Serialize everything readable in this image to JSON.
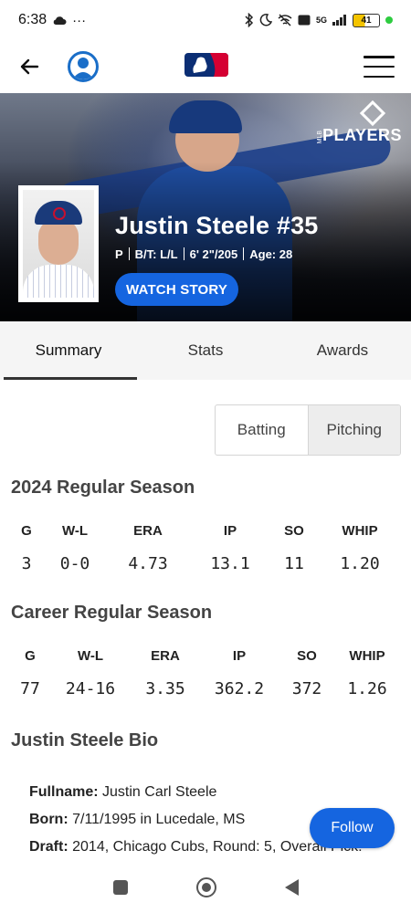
{
  "status_bar": {
    "time": "6:38",
    "dots": "···",
    "network": "5G",
    "battery": "41"
  },
  "nav": {
    "logo_alt": "MLB"
  },
  "hero": {
    "brand": "PLAYERS",
    "brand_small": "MLB",
    "name": "Justin Steele #35",
    "position": "P",
    "bats_throws": "B/T: L/L",
    "height_weight": "6' 2\"/205",
    "age": "Age: 28",
    "watch_label": "WATCH STORY"
  },
  "tabs": [
    {
      "label": "Summary",
      "active": true
    },
    {
      "label": "Stats",
      "active": false
    },
    {
      "label": "Awards",
      "active": false
    }
  ],
  "toggle": {
    "batting": "Batting",
    "pitching": "Pitching",
    "selected": "Pitching"
  },
  "season": {
    "title": "2024 Regular Season",
    "headers": [
      "G",
      "W-L",
      "ERA",
      "IP",
      "SO",
      "WHIP"
    ],
    "values": [
      "3",
      "0-0",
      "4.73",
      "13.1",
      "11",
      "1.20"
    ]
  },
  "career": {
    "title": "Career Regular Season",
    "headers": [
      "G",
      "W-L",
      "ERA",
      "IP",
      "SO",
      "WHIP"
    ],
    "values": [
      "77",
      "24-16",
      "3.35",
      "362.2",
      "372",
      "1.26"
    ]
  },
  "bio": {
    "title": "Justin Steele Bio",
    "fullname_label": "Fullname:",
    "fullname": "Justin Carl Steele",
    "born_label": "Born:",
    "born": "7/11/1995 in Lucedale, MS",
    "draft_label": "Draft:",
    "draft": "2014, Chicago Cubs, Round: 5, Overall Pick:"
  },
  "follow_label": "Follow"
}
